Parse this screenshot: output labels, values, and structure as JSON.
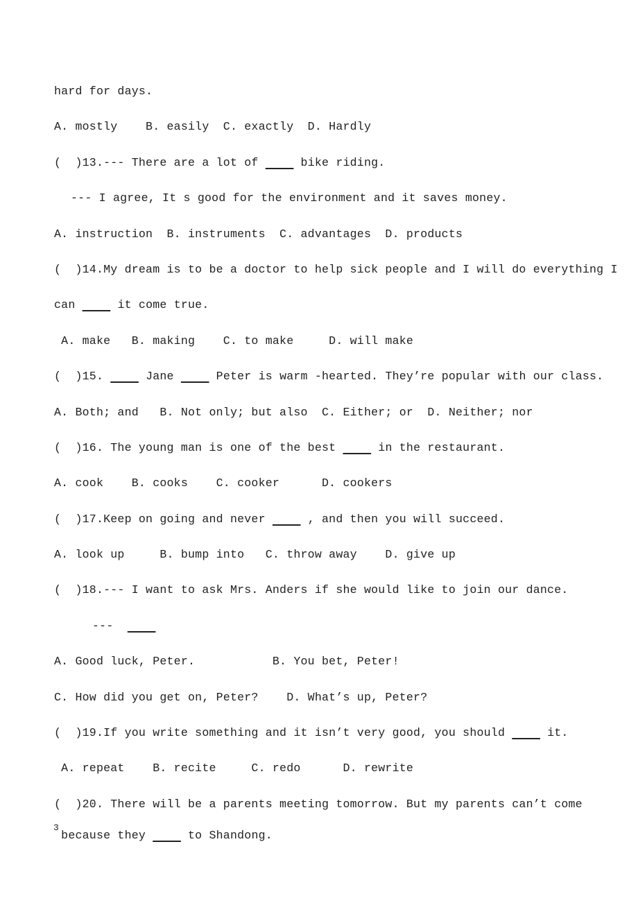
{
  "document": {
    "page_number": "3",
    "lines": [
      {
        "id": "l-hard-for-days",
        "text": "hard for days.",
        "style": "plain",
        "indent": "none",
        "gap": "normal"
      },
      {
        "id": "l-q12-options",
        "text": "A. mostly    B. easily  C. exactly  D. Hardly",
        "style": "plain",
        "indent": "none",
        "gap": "normal"
      },
      {
        "id": "l-q13-stem",
        "text": "(  )13.--- There are a lot of ____ bike riding.",
        "style": "blank",
        "indent": "none",
        "gap": "normal"
      },
      {
        "id": "l-q13-reply",
        "text": "--- I agree, It s good for the environment and it saves money.",
        "style": "plain",
        "indent": "md",
        "gap": "normal"
      },
      {
        "id": "l-q13-options",
        "text": "A. instruction  B. instruments  C. advantages  D. products",
        "style": "plain",
        "indent": "none",
        "gap": "normal"
      },
      {
        "id": "l-q14-stem",
        "text": "(  )14.My dream is to be a doctor to help sick people and I will do everything I",
        "style": "plain",
        "indent": "none",
        "gap": "normal"
      },
      {
        "id": "l-q14-stem-cont",
        "text": "can ____ it come true.",
        "style": "blank",
        "indent": "none",
        "gap": "normal"
      },
      {
        "id": "l-q14-options",
        "text": " A. make   B. making    C. to make     D. will make",
        "style": "plain",
        "indent": "none",
        "gap": "normal"
      },
      {
        "id": "l-q15-stem",
        "text": "(  )15. ____ Jane ____ Peter is warm -hearted. They’re popular with our class.",
        "style": "blank",
        "indent": "none",
        "gap": "normal"
      },
      {
        "id": "l-q15-options",
        "text": "A. Both; and   B. Not only; but also  C. Either; or  D. Neither; nor",
        "style": "plain",
        "indent": "none",
        "gap": "normal"
      },
      {
        "id": "l-q16-stem",
        "text": "(  )16. The young man is one of the best ____ in the restaurant.",
        "style": "blank",
        "indent": "none",
        "gap": "normal"
      },
      {
        "id": "l-q16-options",
        "text": "A. cook    B. cooks    C. cooker      D. cookers",
        "style": "plain",
        "indent": "none",
        "gap": "normal"
      },
      {
        "id": "l-q17-stem",
        "text": "(  )17.Keep on going and never ____ , and then you will succeed.",
        "style": "blank",
        "indent": "none",
        "gap": "normal"
      },
      {
        "id": "l-q17-options",
        "text": "A. look up     B. bump into   C. throw away    D. give up",
        "style": "plain",
        "indent": "none",
        "gap": "normal"
      },
      {
        "id": "l-q18-stem",
        "text": "(  )18.--- I want to ask Mrs. Anders if she would like to join our dance.",
        "style": "plain",
        "indent": "none",
        "gap": "normal"
      },
      {
        "id": "l-q18-reply",
        "text": "---  ____",
        "style": "blank",
        "indent": "lg",
        "gap": "normal"
      },
      {
        "id": "l-q18-options-ab",
        "text": "A. Good luck, Peter.           B. You bet, Peter!",
        "style": "plain",
        "indent": "none",
        "gap": "normal"
      },
      {
        "id": "l-q18-options-cd",
        "text": "C. How did you get on, Peter?    D. What’s up, Peter?",
        "style": "plain",
        "indent": "none",
        "gap": "normal"
      },
      {
        "id": "l-q19-stem",
        "text": "(  )19.If you write something and it isn’t very good, you should ____ it.",
        "style": "blank",
        "indent": "none",
        "gap": "normal"
      },
      {
        "id": "l-q19-options",
        "text": " A. repeat    B. recite     C. redo      D. rewrite",
        "style": "plain",
        "indent": "none",
        "gap": "normal"
      },
      {
        "id": "l-q20-stem",
        "text": "(  )20. There will be a parents meeting tomorrow. But my parents can’t come",
        "style": "plain",
        "indent": "none",
        "gap": "normal"
      },
      {
        "id": "l-q20-stem-cont",
        "text": " because they ____ to Shandong.",
        "style": "blank",
        "indent": "none",
        "gap": "normal"
      }
    ]
  }
}
